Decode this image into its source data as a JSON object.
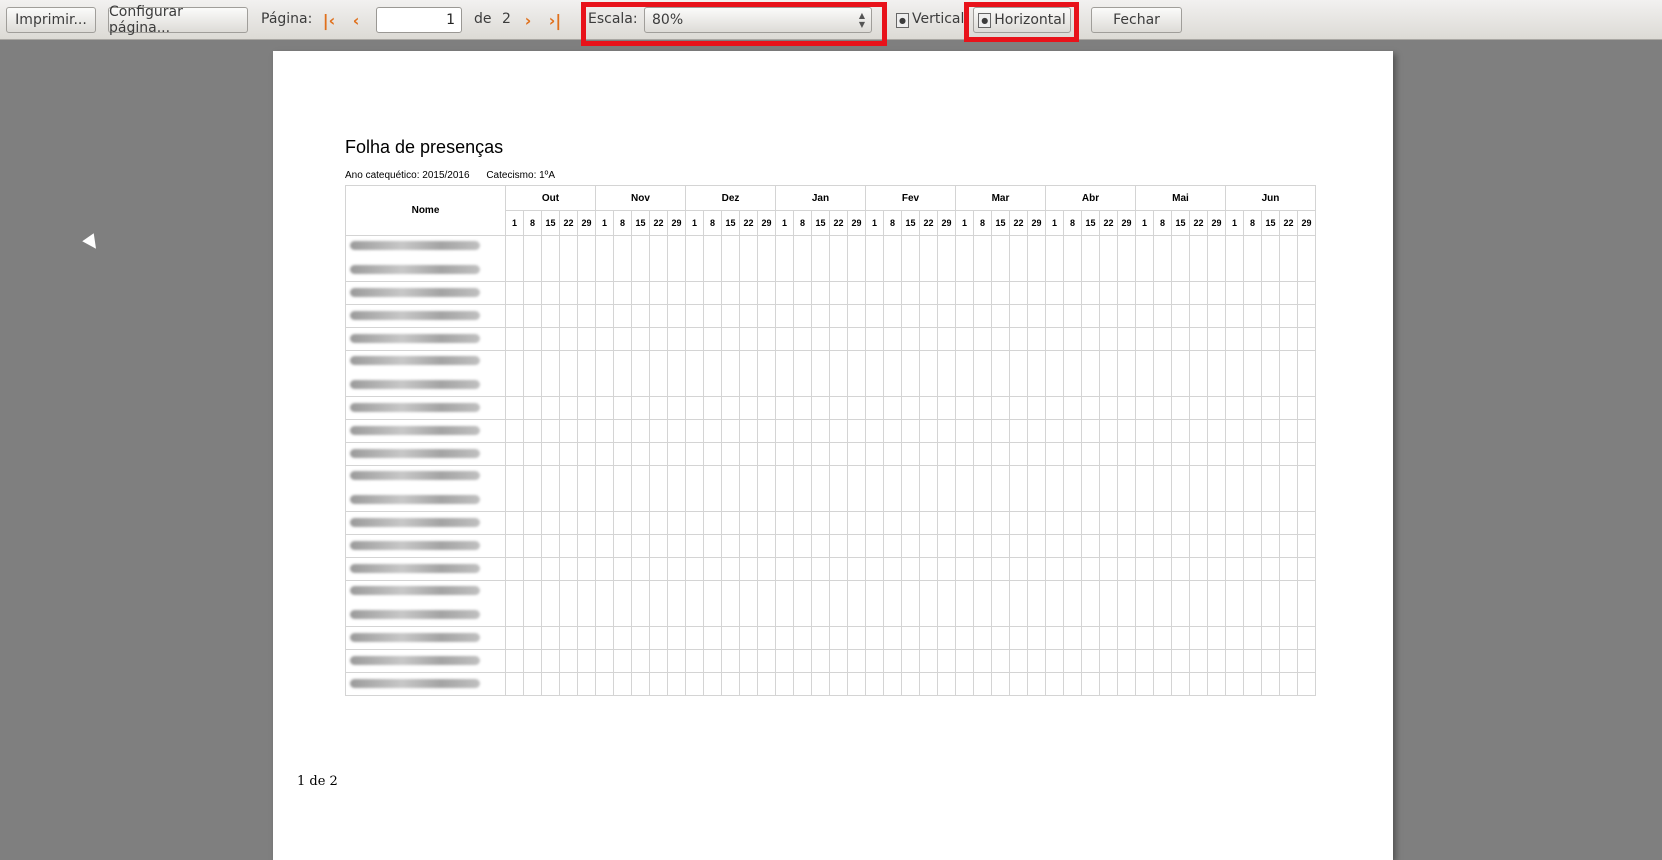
{
  "toolbar": {
    "print_label": "Imprimir...",
    "page_setup_label": "Configurar página...",
    "page_label": "Página:",
    "current_page": "1",
    "of_label": "de",
    "total_pages": "2",
    "scale_label": "Escala:",
    "scale_value": "80%",
    "portrait_label": "Vertical",
    "landscape_label": "Horizontal",
    "close_label": "Fechar"
  },
  "document": {
    "title": "Folha de presenças",
    "school_year": "Ano catequético: 2015/2016",
    "catechism": "Catecismo: 1ºA",
    "name_header": "Nome",
    "months": [
      {
        "name": "Out",
        "days": [
          "1",
          "8",
          "15",
          "22",
          "29"
        ]
      },
      {
        "name": "Nov",
        "days": [
          "1",
          "8",
          "15",
          "22",
          "29"
        ]
      },
      {
        "name": "Dez",
        "days": [
          "1",
          "8",
          "15",
          "22",
          "29"
        ]
      },
      {
        "name": "Jan",
        "days": [
          "1",
          "8",
          "15",
          "22",
          "29"
        ]
      },
      {
        "name": "Fev",
        "days": [
          "1",
          "8",
          "15",
          "22",
          "29"
        ]
      },
      {
        "name": "Mar",
        "days": [
          "1",
          "8",
          "15",
          "22",
          "29"
        ]
      },
      {
        "name": "Abr",
        "days": [
          "1",
          "8",
          "15",
          "22",
          "29"
        ]
      },
      {
        "name": "Mai",
        "days": [
          "1",
          "8",
          "15",
          "22",
          "29"
        ]
      },
      {
        "name": "Jun",
        "days": [
          "1",
          "8",
          "15",
          "22",
          "29"
        ]
      }
    ],
    "footer": "1 de 2"
  },
  "colors": {
    "highlight": "#e8121a",
    "nav_icon": "#e0701c",
    "viewer_background": "#7f7f7f"
  },
  "icons": {
    "first_page": "first-page-icon",
    "prev_page": "previous-page-icon",
    "next_page": "next-page-icon",
    "last_page": "last-page-icon"
  }
}
